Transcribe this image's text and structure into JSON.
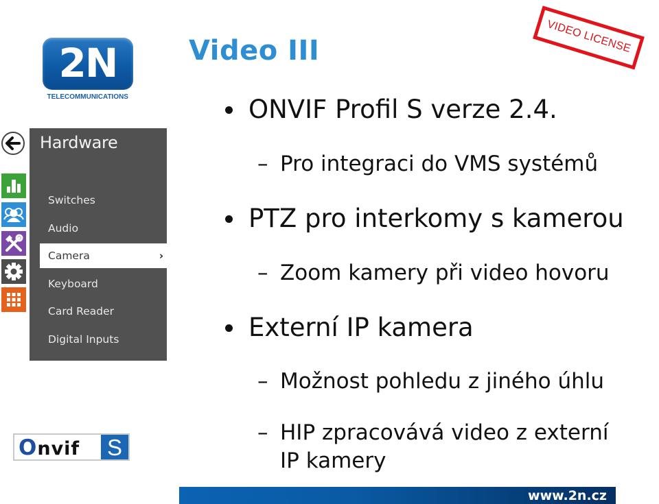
{
  "brand": {
    "logo_text": "2N",
    "tagline": "TELECOMMUNICATIONS",
    "brand_color": "#0d5aa6"
  },
  "slide": {
    "title": "Video III",
    "title_color": "#2f8dd2",
    "stamp_text": "VIDEO LICENSE",
    "stamp_color": "#e1141b",
    "bullets": [
      {
        "text": "ONVIF Profil S verze 2.4.",
        "subs": [
          "Pro integraci do VMS systémů"
        ]
      },
      {
        "text": "PTZ pro interkomy s kamerou",
        "subs": [
          "Zoom kamery při video hovoru"
        ]
      },
      {
        "text": "Externí IP kamera",
        "subs": [
          "Možnost pohledu z jiného úhlu",
          "HIP zpracovává video z externí",
          "IP kamery"
        ]
      }
    ],
    "dash": "–",
    "footer_url": "www.2n.cz"
  },
  "hardware_menu": {
    "back_icon": "arrow-left-icon",
    "side_icons": [
      {
        "name": "status-icon",
        "color": "#3ca33a"
      },
      {
        "name": "users-icon",
        "color": "#2f8fd6"
      },
      {
        "name": "services-icon",
        "color": "#7b48a7"
      },
      {
        "name": "hardware-icon",
        "color": "#4d4d4d"
      },
      {
        "name": "system-icon",
        "color": "#e4621c"
      }
    ],
    "title": "Hardware",
    "items": [
      {
        "label": "Switches"
      },
      {
        "label": "Audio"
      },
      {
        "label": "Camera",
        "active": true,
        "chevron": "›"
      },
      {
        "label": "Keyboard"
      },
      {
        "label": "Card Reader"
      },
      {
        "label": "Digital Inputs"
      }
    ]
  },
  "onvif_logo": {
    "word": "nvif",
    "o": "O",
    "profile": "S"
  }
}
